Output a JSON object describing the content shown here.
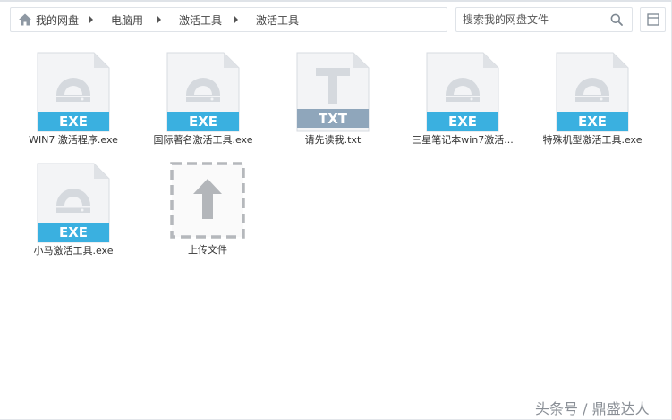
{
  "breadcrumb": {
    "items": [
      "我的网盘",
      "电脑用",
      "激活工具",
      "激活工具"
    ]
  },
  "search": {
    "placeholder": "搜索我的网盘文件"
  },
  "files": [
    {
      "name": "WIN7 激活程序.exe",
      "badge": "EXE",
      "kind": "exe"
    },
    {
      "name": "国际著名激活工具.exe",
      "badge": "EXE",
      "kind": "exe"
    },
    {
      "name": "请先读我.txt",
      "badge": "TXT",
      "kind": "txt"
    },
    {
      "name": "三星笔记本win7激活...",
      "badge": "EXE",
      "kind": "exe"
    },
    {
      "name": "特殊机型激活工具.exe",
      "badge": "EXE",
      "kind": "exe"
    },
    {
      "name": "小马激活工具.exe",
      "badge": "EXE",
      "kind": "exe"
    }
  ],
  "upload": {
    "label": "上传文件"
  },
  "watermark": "头条号 / 鼎盛达人",
  "colors": {
    "exe_badge": "#3ab0e0",
    "txt_badge": "#8fa6bb",
    "doc_body": "#f3f4f6",
    "doc_glyph": "#d5d9de"
  }
}
